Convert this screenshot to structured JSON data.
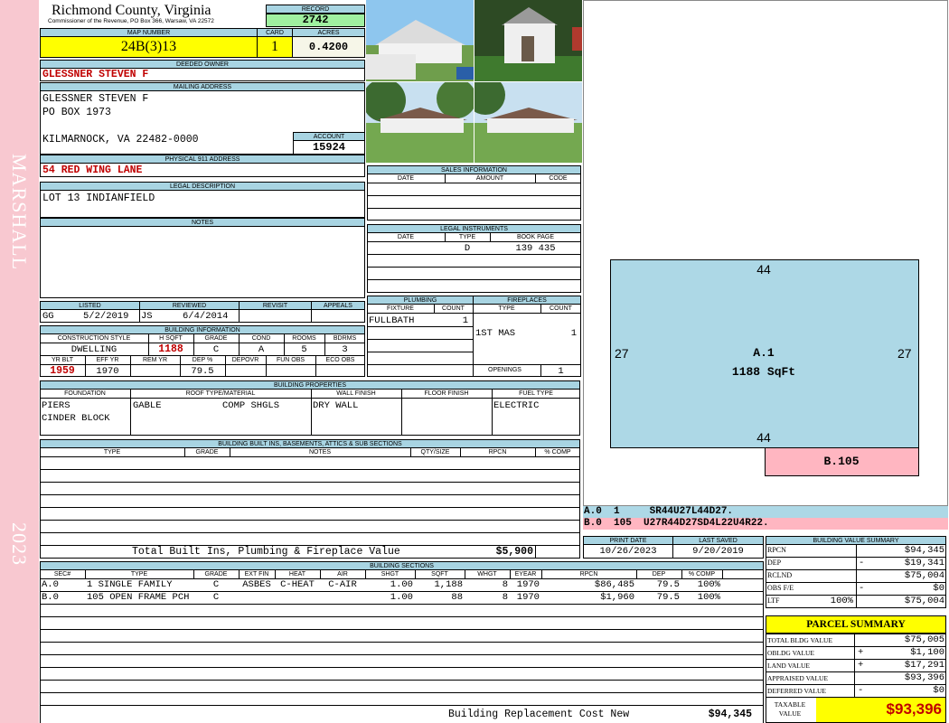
{
  "side": {
    "name": "MARSHALL",
    "year": "2023"
  },
  "header": {
    "county": "Richmond County, Virginia",
    "commissioner": "Commissioner of the Revenue, PO Box 366, Warsaw, VA 22572",
    "record_label": "RECORD",
    "record": "2742",
    "map_label": "MAP NUMBER",
    "map_number": "24B(3)13",
    "card_label": "CARD",
    "card": "1",
    "acres_label": "ACRES",
    "acres": "0.4200"
  },
  "owner": {
    "deeded_label": "DEEDED OWNER",
    "deeded": "GLESSNER STEVEN F",
    "mailing_label": "MAILING ADDRESS",
    "mail1": "GLESSNER STEVEN F",
    "mail2": "PO BOX 1973",
    "mail3": "KILMARNOCK, VA 22482-0000",
    "account_label": "ACCOUNT",
    "account": "15924",
    "physical_label": "PHYSICAL 911 ADDRESS",
    "physical": "54 RED WING LANE",
    "legal_label": "LEGAL DESCRIPTION",
    "legal": "LOT 13 INDIANFIELD",
    "notes_label": "NOTES"
  },
  "listing": {
    "listed_label": "LISTED",
    "reviewed_label": "REVIEWED",
    "revisit_label": "REVISIT",
    "appeals_label": "APPEALS",
    "listed_by": "GG",
    "listed_date": "5/2/2019",
    "reviewed_by": "JS",
    "reviewed_date": "6/4/2014"
  },
  "building_info": {
    "title": "BUILDING INFORMATION",
    "h_style": "CONSTRUCTION STYLE",
    "h_sqft": "H SQFT",
    "h_grade": "GRADE",
    "h_cond": "COND",
    "h_rooms": "ROOMS",
    "h_bdrms": "BDRMS",
    "style": "DWELLING",
    "sqft": "1188",
    "grade": "C",
    "cond": "A",
    "rooms": "5",
    "bdrms": "3",
    "h_yrblt": "YR BLT",
    "h_effyr": "EFF YR",
    "h_remyr": "REM YR",
    "h_dep": "DEP %",
    "h_depovr": "DEPOVR",
    "h_funobs": "FUN OBS",
    "h_ecoobs": "ECO OBS",
    "yrblt": "1959",
    "effyr": "1970",
    "dep": "79.5"
  },
  "sales": {
    "title": "SALES INFORMATION",
    "h_date": "DATE",
    "h_amount": "AMOUNT",
    "h_code": "CODE",
    "legal_title": "LEGAL INSTRUMENTS",
    "h_ldate": "DATE",
    "h_type": "TYPE",
    "h_bookpage": "BOOK PAGE",
    "instr_type": "D",
    "instr_bookpage": "139 435"
  },
  "plumbing": {
    "title": "PLUMBING",
    "h_fixture": "FIXTURE",
    "h_count": "COUNT",
    "fixture": "FULLBATH",
    "count": "1",
    "fp_title": "FIREPLACES",
    "h_fptype": "TYPE",
    "h_fpcount": "COUNT",
    "fptype": "1ST MAS",
    "fpcount": "1",
    "openings_label": "OPENINGS",
    "openings": "1"
  },
  "properties": {
    "title": "BUILDING PROPERTIES",
    "h_found": "FOUNDATION",
    "h_roof": "ROOF TYPE/MATERIAL",
    "h_wall": "WALL FINISH",
    "h_floor": "FLOOR FINISH",
    "h_fuel": "FUEL TYPE",
    "found1": "PIERS",
    "found2": "CINDER BLOCK",
    "roof_type": "GABLE",
    "roof_mat": "COMP SHGLS",
    "wall": "DRY WALL",
    "fuel": "ELECTRIC"
  },
  "builtins": {
    "title": "BUILDING BUILT INS, BASEMENTS, ATTICS & SUB SECTIONS",
    "h_type": "TYPE",
    "h_grade": "GRADE",
    "h_notes": "NOTES",
    "h_qty": "QTY/SIZE",
    "h_rpcn": "RPCN",
    "h_comp": "% COMP",
    "total_label": "Total Built Ins, Plumbing & Fireplace Value",
    "total": "$5,900"
  },
  "dates": {
    "print_label": "PRINT DATE",
    "print": "10/26/2023",
    "saved_label": "LAST SAVED",
    "saved": "9/20/2019"
  },
  "sections": {
    "title": "BUILDING SECTIONS",
    "headers": [
      "SEC#",
      "TYPE",
      "GRADE",
      "EXT FIN",
      "HEAT",
      "AIR",
      "SHGT",
      "SQFT",
      "WHGT",
      "EYEAR",
      "RPCN",
      "DEP",
      "% COMP"
    ],
    "rows": [
      [
        "A.0",
        "1 SINGLE FAMILY",
        "C",
        "ASBES",
        "C-HEAT",
        "C-AIR",
        "1.00",
        "1,188",
        "8",
        "1970",
        "$86,485",
        "79.5",
        "100%"
      ],
      [
        "B.0",
        "105 OPEN FRAME PCH",
        "C",
        "",
        "",
        "",
        "1.00",
        "88",
        "8",
        "1970",
        "$1,960",
        "79.5",
        "100%"
      ]
    ],
    "replacement_label": "Building Replacement Cost New",
    "replacement": "$94,345"
  },
  "sketch": {
    "top": "44",
    "bottom": "44",
    "left": "27",
    "right": "27",
    "main_label": "A.1",
    "main_area": "1188 SqFt",
    "porch_label": "B.105",
    "line_a": "A.0  1     SR44U27L44D27.",
    "line_b": "B.0  105  U27R44D27SD4L22U4R22."
  },
  "value_summary": {
    "title": "BUILDING VALUE SUMMARY",
    "rows": [
      {
        "label": "RPCN",
        "sign": "",
        "value": "$94,345"
      },
      {
        "label": "DEP",
        "sign": "-",
        "value": "$19,341"
      },
      {
        "label": "RCLND",
        "sign": "",
        "value": "$75,004"
      },
      {
        "label": "OBS F/E",
        "sign": "-",
        "value": "$0"
      },
      {
        "label": "LTF",
        "sign": "",
        "value": "$75,004"
      }
    ],
    "ltf_pct": "100%"
  },
  "parcel": {
    "title": "PARCEL SUMMARY",
    "rows": [
      {
        "label": "TOTAL BLDG VALUE",
        "sign": "",
        "value": "$75,005"
      },
      {
        "label": "OBLDG VALUE",
        "sign": "+",
        "value": "$1,100"
      },
      {
        "label": "LAND VALUE",
        "sign": "+",
        "value": "$17,291"
      },
      {
        "label": "APPRAISED VALUE",
        "sign": "",
        "value": "$93,396"
      },
      {
        "label": "DEFERRED VALUE",
        "sign": "-",
        "value": "$0"
      }
    ],
    "taxable_label1": "TAXABLE",
    "taxable_label2": "VALUE",
    "taxable": "$93,396"
  },
  "colors": {
    "header_blue": "#a8d4e2",
    "yellow": "#ffff00",
    "green": "#a0f0a0",
    "side_pink": "#f8c8d0",
    "value_red": "#c00000",
    "sketch_blue": "#add8e6",
    "porch_pink": "#ffb6c1"
  }
}
